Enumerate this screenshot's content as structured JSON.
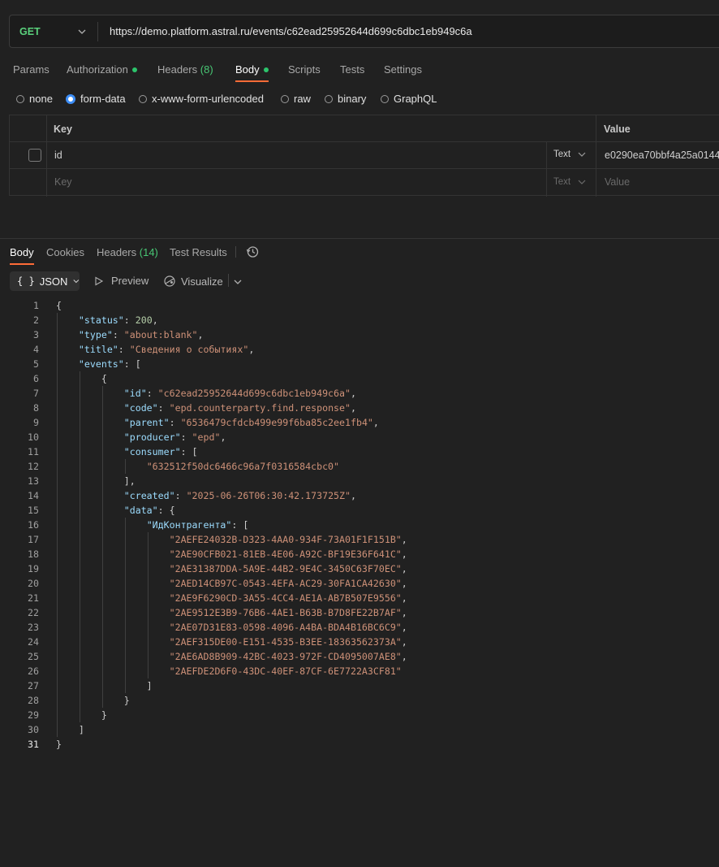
{
  "request": {
    "method": "GET",
    "url": "https://demo.platform.astral.ru/events/c62ead25952644d699c6dbc1eb949c6a"
  },
  "request_tabs": [
    {
      "label": "Params"
    },
    {
      "label": "Authorization"
    },
    {
      "label": "Headers",
      "count": "(8)"
    },
    {
      "label": "Body"
    },
    {
      "label": "Scripts"
    },
    {
      "label": "Tests"
    },
    {
      "label": "Settings"
    }
  ],
  "body_types": [
    "none",
    "form-data",
    "x-www-form-urlencoded",
    "raw",
    "binary",
    "GraphQL"
  ],
  "selected_body_type": "form-data",
  "form_table": {
    "headers": {
      "key": "Key",
      "value": "Value"
    },
    "rows": [
      {
        "key": "id",
        "type": "Text",
        "value": "e0290ea70bbf4a25a0144"
      }
    ],
    "placeholder": {
      "key": "Key",
      "type": "Text",
      "value": "Value"
    }
  },
  "response_tabs": [
    {
      "label": "Body"
    },
    {
      "label": "Cookies"
    },
    {
      "label": "Headers",
      "count": "(14)"
    },
    {
      "label": "Test Results"
    }
  ],
  "response_toolbar": {
    "format": "JSON",
    "format_icon": "{ }",
    "preview": "Preview",
    "visualize": "Visualize"
  },
  "code_lines": [
    "{",
    "    \"status\": 200,",
    "    \"type\": \"about:blank\",",
    "    \"title\": \"Сведения о событиях\",",
    "    \"events\": [",
    "        {",
    "            \"id\": \"c62ead25952644d699c6dbc1eb949c6a\",",
    "            \"code\": \"epd.counterparty.find.response\",",
    "            \"parent\": \"6536479cfdcb499e99f6ba85c2ee1fb4\",",
    "            \"producer\": \"epd\",",
    "            \"consumer\": [",
    "                \"632512f50dc6466c96a7f0316584cbc0\"",
    "            ],",
    "            \"created\": \"2025-06-26T06:30:42.173725Z\",",
    "            \"data\": {",
    "                \"ИдКонтрагента\": [",
    "                    \"2AEFE24032B-D323-4AA0-934F-73A01F1F151B\",",
    "                    \"2AE90CFB021-81EB-4E06-A92C-BF19E36F641C\",",
    "                    \"2AE31387DDA-5A9E-44B2-9E4C-3450C63F70EC\",",
    "                    \"2AED14CB97C-0543-4EFA-AC29-30FA1CA42630\",",
    "                    \"2AE9F6290CD-3A55-4CC4-AE1A-AB7B507E9556\",",
    "                    \"2AE9512E3B9-76B6-4AE1-B63B-B7D8FE22B7AF\",",
    "                    \"2AE07D31E83-0598-4096-A4BA-BDA4B16BC6C9\",",
    "                    \"2AEF315DE00-E151-4535-B3EE-18363562373A\",",
    "                    \"2AE6AD8B909-42BC-4023-972F-CD4095007AE8\",",
    "                    \"2AEFDE2D6F0-43DC-40EF-87CF-6E7722A3CF81\"",
    "                ]",
    "            }",
    "        }",
    "    ]",
    "}"
  ],
  "colors": {
    "accent": "#ff6c37",
    "method": "#5ad17c",
    "json_key": "#9cdcfe",
    "json_string": "#ce9178",
    "json_number": "#b5cea8"
  }
}
